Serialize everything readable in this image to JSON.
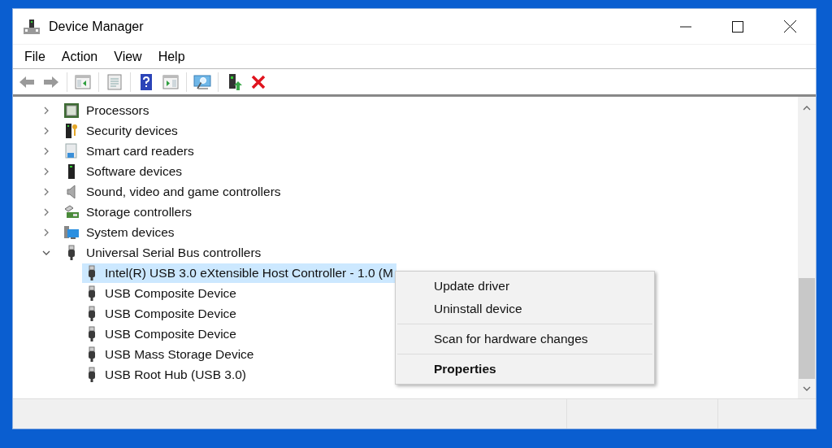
{
  "window": {
    "title": "Device Manager"
  },
  "menu_bar": [
    "File",
    "Action",
    "View",
    "Help"
  ],
  "toolbar": [
    {
      "kind": "back"
    },
    {
      "kind": "forward"
    },
    {
      "kind": "separator"
    },
    {
      "kind": "tree"
    },
    {
      "kind": "separator"
    },
    {
      "kind": "properties"
    },
    {
      "kind": "separator"
    },
    {
      "kind": "help"
    },
    {
      "kind": "pane"
    },
    {
      "kind": "separator"
    },
    {
      "kind": "scan"
    },
    {
      "kind": "separator"
    },
    {
      "kind": "update"
    },
    {
      "kind": "uninstall"
    }
  ],
  "tree": [
    {
      "label": "Processors",
      "kind": "processor",
      "expanded": false
    },
    {
      "label": "Security devices",
      "kind": "security",
      "expanded": false
    },
    {
      "label": "Smart card readers",
      "kind": "smartcard",
      "expanded": false
    },
    {
      "label": "Software devices",
      "kind": "software",
      "expanded": false
    },
    {
      "label": "Sound, video and game controllers",
      "kind": "sound",
      "expanded": false
    },
    {
      "label": "Storage controllers",
      "kind": "storage",
      "expanded": false
    },
    {
      "label": "System devices",
      "kind": "system",
      "expanded": false
    },
    {
      "label": "Universal Serial Bus controllers",
      "kind": "usb",
      "expanded": true,
      "children": [
        {
          "label": "Intel(R) USB 3.0 eXtensible Host Controller - 1.0 (M",
          "kind": "usb",
          "selected": true
        },
        {
          "label": "USB Composite Device",
          "kind": "usb",
          "selected": false
        },
        {
          "label": "USB Composite Device",
          "kind": "usb",
          "selected": false
        },
        {
          "label": "USB Composite Device",
          "kind": "usb",
          "selected": false
        },
        {
          "label": "USB Mass Storage Device",
          "kind": "usb",
          "selected": false
        },
        {
          "label": "USB Root Hub (USB 3.0)",
          "kind": "usb",
          "selected": false
        }
      ]
    }
  ],
  "context_menu": [
    {
      "kind": "item",
      "label": "Update driver",
      "default": false
    },
    {
      "kind": "item",
      "label": "Uninstall device",
      "default": false
    },
    {
      "kind": "separator"
    },
    {
      "kind": "item",
      "label": "Scan for hardware changes",
      "default": false
    },
    {
      "kind": "separator"
    },
    {
      "kind": "item",
      "label": "Properties",
      "default": true
    }
  ]
}
